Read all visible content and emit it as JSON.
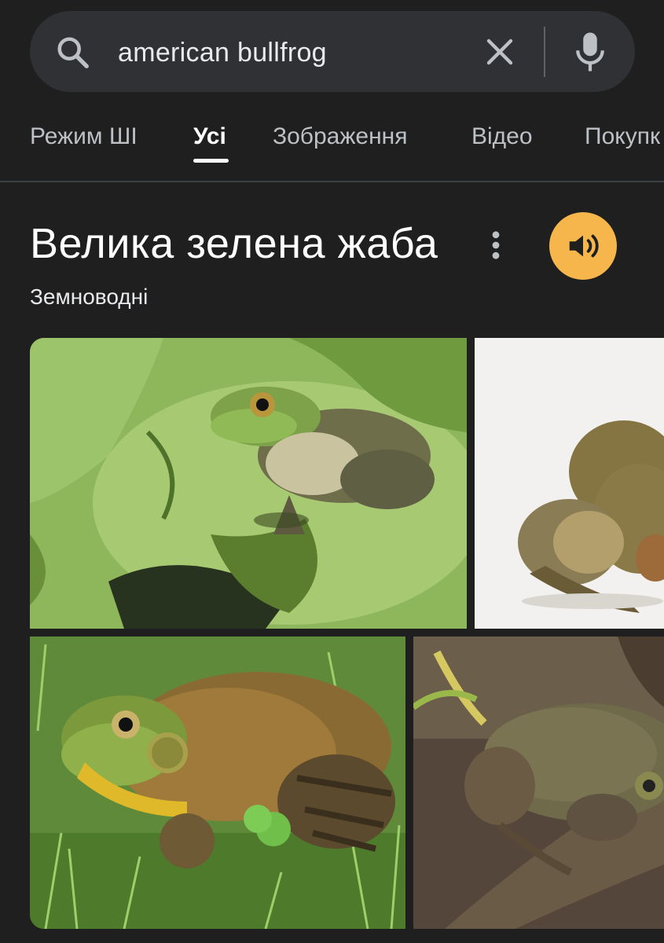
{
  "search": {
    "query": "american bullfrog"
  },
  "tabs": [
    {
      "label": "Режим ШІ",
      "active": false
    },
    {
      "label": "Усі",
      "active": true
    },
    {
      "label": "Зображення",
      "active": false
    },
    {
      "label": "Відео",
      "active": false
    },
    {
      "label": "Покупк",
      "active": false
    }
  ],
  "knowledge_panel": {
    "title": "Велика зелена жаба",
    "subtitle": "Земноводні"
  },
  "colors": {
    "background": "#1f1f1f",
    "search_bar": "#303134",
    "speaker_accent": "#f6b64b"
  },
  "icons": {
    "search": "search-icon",
    "clear": "close-icon",
    "mic": "mic-icon",
    "more": "more-vert-icon",
    "speaker": "volume-icon"
  }
}
